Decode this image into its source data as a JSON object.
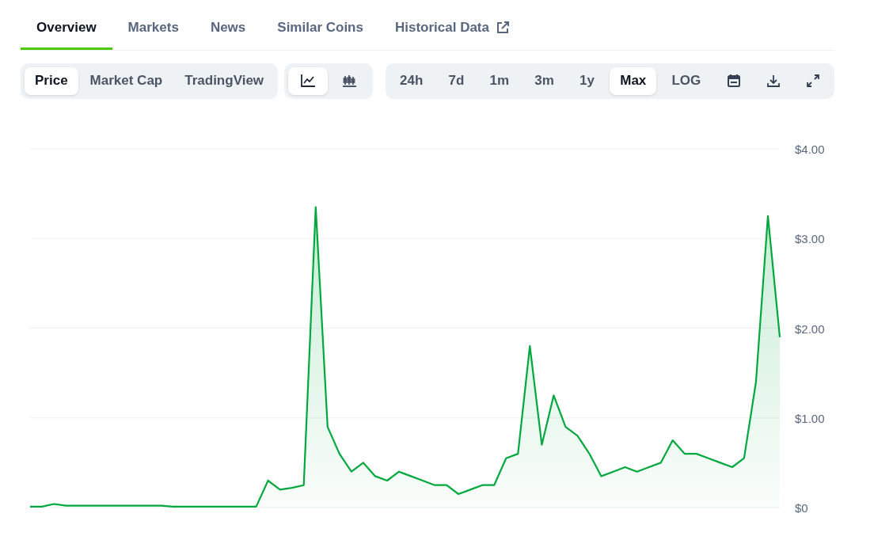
{
  "tabs": [
    {
      "label": "Overview",
      "selected": true,
      "external": false
    },
    {
      "label": "Markets",
      "selected": false,
      "external": false
    },
    {
      "label": "News",
      "selected": false,
      "external": false
    },
    {
      "label": "Similar Coins",
      "selected": false,
      "external": false
    },
    {
      "label": "Historical Data",
      "selected": false,
      "external": true
    }
  ],
  "chart_types": [
    {
      "label": "Price",
      "selected": true
    },
    {
      "label": "Market Cap",
      "selected": false
    },
    {
      "label": "TradingView",
      "selected": false
    }
  ],
  "chart_styles": [
    {
      "kind": "line",
      "selected": true
    },
    {
      "kind": "candlestick",
      "selected": false
    }
  ],
  "ranges": [
    {
      "label": "24h",
      "selected": false
    },
    {
      "label": "7d",
      "selected": false
    },
    {
      "label": "1m",
      "selected": false
    },
    {
      "label": "3m",
      "selected": false
    },
    {
      "label": "1y",
      "selected": false
    },
    {
      "label": "Max",
      "selected": true
    },
    {
      "label": "LOG",
      "selected": false
    }
  ],
  "actions": [
    {
      "kind": "calendar"
    },
    {
      "kind": "download"
    },
    {
      "kind": "fullscreen"
    }
  ],
  "chart": {
    "chart_data": {
      "type": "area",
      "grid": true,
      "ylim": [
        0,
        4
      ],
      "yticks": [
        {
          "value": 0,
          "label": "$0"
        },
        {
          "value": 1,
          "label": "$1.00"
        },
        {
          "value": 2,
          "label": "$2.00"
        },
        {
          "value": 3,
          "label": "$3.00"
        },
        {
          "value": 4,
          "label": "$4.00"
        }
      ],
      "series": [
        {
          "color": "#00a83e",
          "values": [
            0.01,
            0.01,
            0.04,
            0.02,
            0.02,
            0.02,
            0.02,
            0.02,
            0.02,
            0.02,
            0.02,
            0.02,
            0.01,
            0.01,
            0.01,
            0.01,
            0.01,
            0.01,
            0.01,
            0.01,
            0.3,
            0.2,
            0.22,
            0.25,
            3.35,
            0.9,
            0.6,
            0.4,
            0.5,
            0.35,
            0.3,
            0.4,
            0.35,
            0.3,
            0.25,
            0.25,
            0.15,
            0.2,
            0.25,
            0.25,
            0.55,
            0.6,
            1.8,
            0.7,
            1.25,
            0.9,
            0.8,
            0.6,
            0.35,
            0.4,
            0.45,
            0.4,
            0.45,
            0.5,
            0.75,
            0.6,
            0.6,
            0.55,
            0.5,
            0.45,
            0.55,
            1.4,
            3.25,
            1.9
          ]
        }
      ]
    }
  }
}
